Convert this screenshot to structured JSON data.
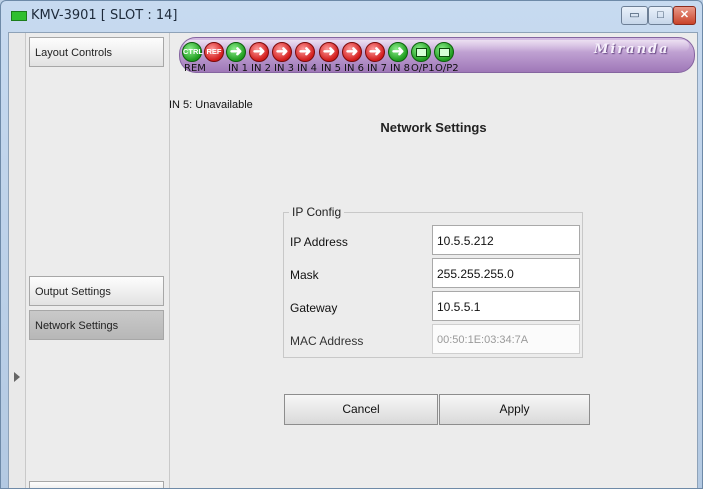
{
  "window": {
    "title": "KMV-3901 [ SLOT : 14]",
    "controls": {
      "minimize": "▭",
      "maximize": "□",
      "close": "✕"
    }
  },
  "sidebar": {
    "items": [
      {
        "label": "Layout Controls",
        "active": false
      },
      {
        "label": "Output Settings",
        "active": false
      },
      {
        "label": "Network Settings",
        "active": true
      }
    ]
  },
  "status_bar": {
    "brand": "Miranda",
    "indicators": [
      {
        "icon": "ctrl",
        "badge": "CTRL",
        "label": "REM",
        "color": "green"
      },
      {
        "icon": "ref",
        "badge": "REF",
        "label": "",
        "color": "red"
      },
      {
        "icon": "input-arrow",
        "label": "IN 1",
        "color": "green"
      },
      {
        "icon": "input-arrow",
        "label": "IN 2",
        "color": "red"
      },
      {
        "icon": "input-arrow",
        "label": "IN 3",
        "color": "red"
      },
      {
        "icon": "input-arrow",
        "label": "IN 4",
        "color": "red"
      },
      {
        "icon": "input-arrow",
        "label": "IN 5",
        "color": "red"
      },
      {
        "icon": "input-arrow",
        "label": "IN 6",
        "color": "red"
      },
      {
        "icon": "input-arrow",
        "label": "IN 7",
        "color": "red"
      },
      {
        "icon": "input-arrow",
        "label": "IN 8",
        "color": "green"
      },
      {
        "icon": "monitor",
        "label": "O/P1",
        "color": "green"
      },
      {
        "icon": "monitor",
        "label": "O/P2",
        "color": "green"
      }
    ],
    "colors": {
      "green": "#1e9c1e",
      "red": "#d21b1b",
      "pill": "#9f78b8"
    }
  },
  "status_text": "IN 5: Unavailable",
  "page": {
    "title": "Network Settings",
    "ip_config": {
      "legend": "IP Config",
      "fields": [
        {
          "label": "IP Address",
          "value": "10.5.5.212",
          "editable": true
        },
        {
          "label": "Mask",
          "value": "255.255.255.0",
          "editable": true
        },
        {
          "label": "Gateway",
          "value": "10.5.5.1",
          "editable": true
        },
        {
          "label": "MAC Address",
          "value": "00:50:1E:03:34:7A",
          "editable": false
        }
      ]
    },
    "buttons": {
      "cancel": "Cancel",
      "apply": "Apply"
    }
  }
}
